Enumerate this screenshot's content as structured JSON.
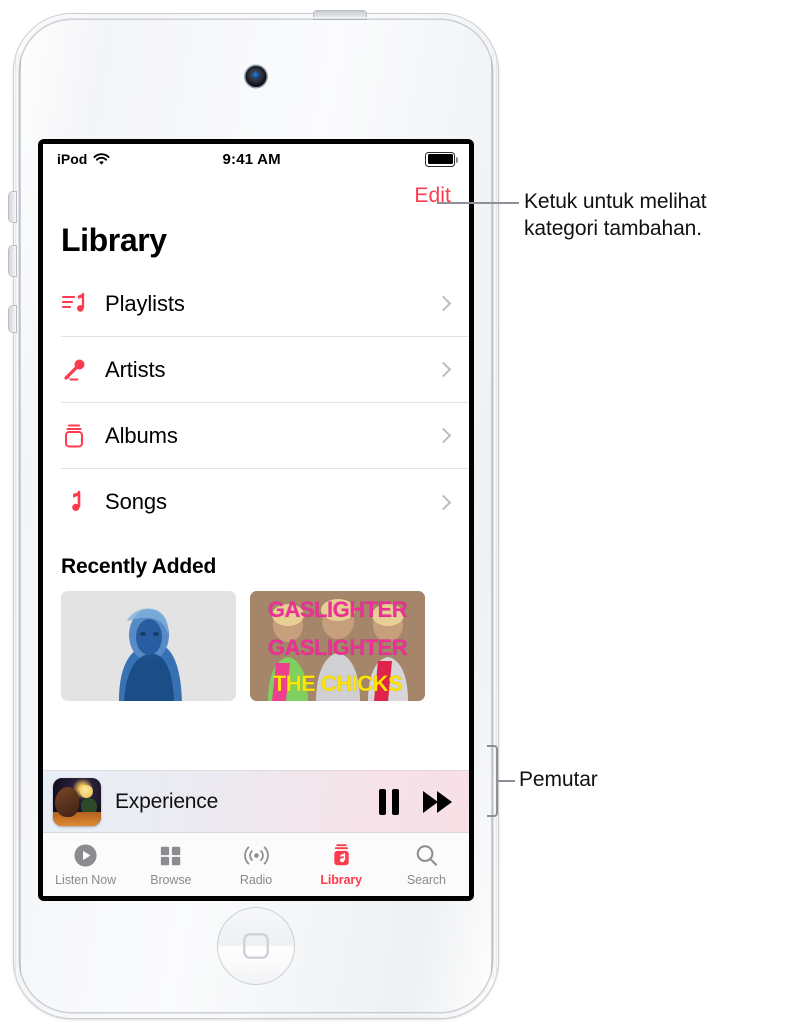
{
  "status_bar": {
    "carrier": "iPod",
    "wifi_icon": "wifi-icon",
    "time": "9:41 AM",
    "battery_icon": "battery-full-icon"
  },
  "screen": {
    "edit_label": "Edit",
    "page_title": "Library",
    "library_items": [
      {
        "label": "Playlists",
        "icon": "playlist-note-icon"
      },
      {
        "label": "Artists",
        "icon": "microphone-icon"
      },
      {
        "label": "Albums",
        "icon": "album-stack-icon"
      },
      {
        "label": "Songs",
        "icon": "music-note-icon"
      }
    ],
    "recently_added_title": "Recently Added",
    "albums": [
      {
        "name": "blue-portrait-album-art",
        "lines": []
      },
      {
        "name": "gaslighter-album-art",
        "lines": [
          "GASLIGHTER",
          "GASLIGHTER",
          "THE CHICKS"
        ]
      }
    ],
    "now_playing": {
      "artwork": "night-moon-album-art",
      "title": "Experience",
      "pause_icon": "pause-icon",
      "forward_icon": "fast-forward-icon"
    },
    "tabs": [
      {
        "label": "Listen Now",
        "icon": "play-circle-icon",
        "active": false
      },
      {
        "label": "Browse",
        "icon": "grid-squares-icon",
        "active": false
      },
      {
        "label": "Radio",
        "icon": "radio-waves-icon",
        "active": false
      },
      {
        "label": "Library",
        "icon": "library-icon",
        "active": true
      },
      {
        "label": "Search",
        "icon": "search-icon",
        "active": false
      }
    ]
  },
  "callouts": {
    "edit": "Ketuk untuk melihat\nkategori tambahan.",
    "edit_line1": "Ketuk untuk melihat",
    "edit_line2": "kategori tambahan.",
    "player": "Pemutar"
  },
  "colors": {
    "accent_red": "#FC3B4E",
    "magenta": "#F22E9B",
    "yellow": "#FFE500",
    "leader_gray": "#8D9095"
  }
}
